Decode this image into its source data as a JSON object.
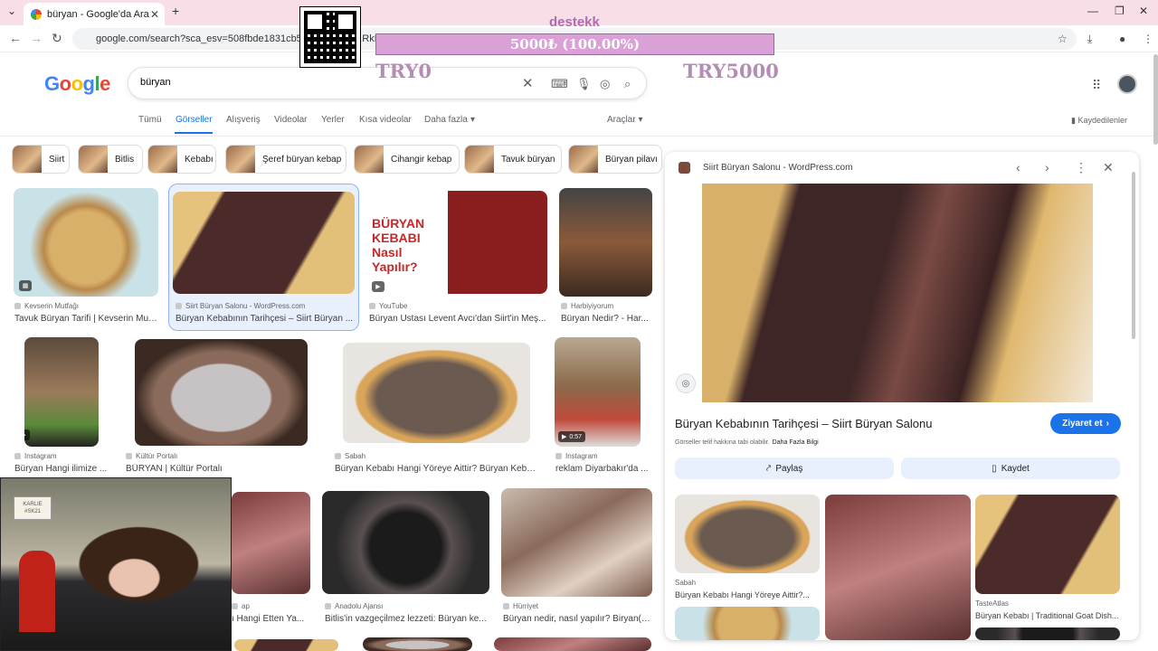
{
  "browser": {
    "tab_title": "büryan - Google'da Ara",
    "url": "google.com/search?sca_esv=508fbde1831cb55a&sxs...LP...RkPlLfDIfEXPwaXG5eHvO7qyO_mxvB-_pt2ZyNJlVa-ipFUKOHx33VDPeEM..."
  },
  "overlay": {
    "donate_title": "destekk",
    "donate_progress": "5000₺ (100.00%)",
    "donate_fraction": 1.0,
    "try_min": "TRY0",
    "try_max": "TRY5000"
  },
  "search": {
    "logo": "Google",
    "query": "büryan"
  },
  "tabs": [
    "Tümü",
    "Görseller",
    "Alışveriş",
    "Videolar",
    "Yerler",
    "Kısa videolar",
    "Daha fazla"
  ],
  "tools_label": "Araçlar",
  "saved_label": "Kaydedilenler",
  "chips": [
    "Siirt",
    "Bitlis",
    "Kebabı",
    "Şeref büryan kebap",
    "Cihangir kebap",
    "Tavuk büryan",
    "Büryan pilavı"
  ],
  "results": [
    {
      "source": "Kevserin Mutfağı",
      "caption": "Tavuk Büryan Tarifi | Kevserin Mutf..."
    },
    {
      "source": "Siirt Büryan Salonu - WordPress.com",
      "caption": "Büryan Kebabının Tarihçesi – Siirt Büryan ..."
    },
    {
      "source": "YouTube",
      "caption": "Büryan Ustası Levent Avcı'dan Siirt'in Meş..."
    },
    {
      "source": "Harbiyiyorum",
      "caption": "Büryan Nedir? - Har..."
    },
    {
      "source": "Instagram",
      "caption": "Büryan Hangi ilimize ..."
    },
    {
      "source": "Kültür Portalı",
      "caption": "BÜRYAN | Kültür Portalı"
    },
    {
      "source": "Sabah",
      "caption": "Büryan Kebabı Hangi Yöreye Aittir? Büryan Kebab..."
    },
    {
      "source": "Instagram",
      "caption": "reklam Diyarbakır'da ..."
    },
    {
      "source": "ap",
      "caption": "ı Hangi Etten Ya..."
    },
    {
      "source": "Anadolu Ajansı",
      "caption": "Bitlis'in vazgeçilmez lezzeti: Büryan ke..."
    },
    {
      "source": "Hürriyet",
      "caption": "Büryan nedir, nasıl yapılır? Biryan(b..."
    }
  ],
  "video_duration": "0:57",
  "thumb_text": {
    "overlay_word": "Kevserin Mutfağı",
    "yt_text": "BÜRYAN KEBABI Nasıl Yapılır?"
  },
  "panel": {
    "source": "Siirt Büryan Salonu - WordPress.com",
    "title": "Büryan Kebabının Tarihçesi – Siirt Büryan Salonu",
    "visit": "Ziyaret et",
    "copyright": "Görseller telif hakkına tabi olabilir.",
    "more_info": "Daha Fazla Bilgi",
    "share": "Paylaş",
    "save": "Kaydet",
    "related": [
      {
        "source": "Sabah",
        "caption": "Büryan Kebabı Hangi Yöreye Aittir?..."
      },
      {
        "source": "TasteAtlas",
        "caption": "Büryan Kebabı | Traditional Goat Dish..."
      }
    ]
  },
  "webcam_note": "KARLIE #SK21"
}
